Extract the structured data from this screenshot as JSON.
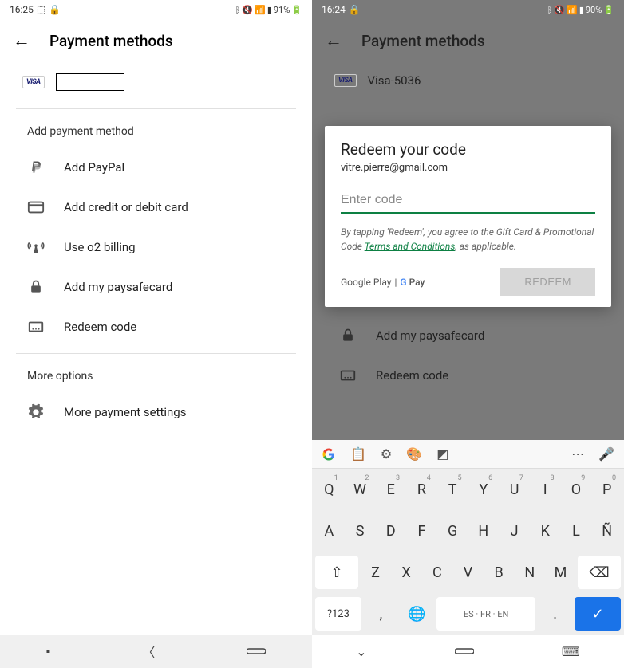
{
  "left": {
    "status": {
      "time": "16:25",
      "battery": "91%"
    },
    "header": {
      "title": "Payment methods"
    },
    "visa": {
      "label": "VISA"
    },
    "add_section": "Add payment method",
    "items": [
      {
        "label": "Add PayPal"
      },
      {
        "label": "Add credit or debit card"
      },
      {
        "label": "Use o2 billing"
      },
      {
        "label": "Add my paysafecard"
      },
      {
        "label": "Redeem code"
      }
    ],
    "more_section": "More options",
    "more_item": "More payment settings"
  },
  "right": {
    "status": {
      "time": "16:24",
      "battery": "90%"
    },
    "header": {
      "title": "Payment methods"
    },
    "visa": {
      "label": "VISA",
      "card": "Visa-5036"
    },
    "dialog": {
      "title": "Redeem your code",
      "email": "vitre.pierre@gmail.com",
      "placeholder": "Enter code",
      "text_pre": "By tapping 'Redeem', you agree to the Gift Card & Promotional Code ",
      "terms": "Terms and Conditions",
      "text_post": ", as applicable.",
      "brand1": "Google Play",
      "brand2": "G Pay",
      "redeem": "REDEEM"
    },
    "dim_items": [
      {
        "label": "Add my paysafecard"
      },
      {
        "label": "Redeem code"
      }
    ],
    "keyboard": {
      "spacebar": "ES · FR · EN",
      "nums": "?123",
      "row1": [
        "Q",
        "W",
        "E",
        "R",
        "T",
        "Y",
        "U",
        "I",
        "O",
        "P"
      ],
      "row1n": [
        "1",
        "2",
        "3",
        "4",
        "5",
        "6",
        "7",
        "8",
        "9",
        "0"
      ],
      "row2": [
        "A",
        "S",
        "D",
        "F",
        "G",
        "H",
        "J",
        "K",
        "L",
        "Ñ"
      ],
      "row3": [
        "Z",
        "X",
        "C",
        "V",
        "B",
        "N",
        "M"
      ]
    }
  }
}
